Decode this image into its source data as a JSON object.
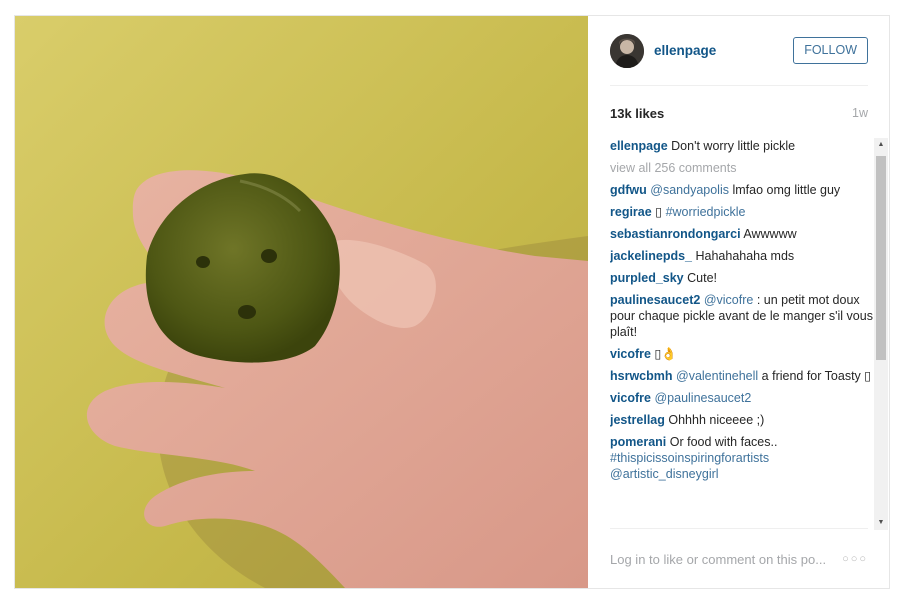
{
  "post": {
    "username": "ellenpage",
    "follow_label": "FOLLOW",
    "likes": "13k likes",
    "age": "1w",
    "caption": {
      "user": "ellenpage",
      "text": "Don't worry little pickle"
    },
    "view_all": "view all 256 comments"
  },
  "comments": [
    {
      "user": "gdfwu",
      "mention": "@sandyapolis",
      "text": "lmfao omg little guy"
    },
    {
      "user": "regirae",
      "mention": "#worriedpickle",
      "text": "▯"
    },
    {
      "user": "sebastianrondongarci",
      "mention": "",
      "text": "Awwwww"
    },
    {
      "user": "jackelinepds_",
      "mention": "",
      "text": "Hahahahaha mds"
    },
    {
      "user": "purpled_sky",
      "mention": "",
      "text": "Cute!"
    },
    {
      "user": "paulinesaucet2",
      "mention": "@vicofre",
      "text": ": un petit mot doux pour chaque pickle avant de le manger s'il vous plaît!"
    },
    {
      "user": "vicofre",
      "mention": "",
      "text": "▯👌"
    },
    {
      "user": "hsrwcbmh",
      "mention": "@valentinehell",
      "text": "a friend for Toasty ▯"
    },
    {
      "user": "vicofre",
      "mention": "@paulinesaucet2",
      "text": ""
    },
    {
      "user": "jestrellag",
      "mention": "",
      "text": "Ohhhh niceeee ;)"
    },
    {
      "user": "pomerani",
      "mention": "",
      "text": "Or food with faces..",
      "tags": "#thispicissoinspiringforartists @artistic_disneygirl"
    }
  ],
  "footer": {
    "login_text": "Log in to like or comment on this po...",
    "more": "○○○"
  },
  "scrollbar": {
    "up": "▲",
    "down": "▼"
  },
  "colors": {
    "username_blue": "#125688",
    "follow_blue": "#3f729b",
    "muted_grey": "#a5a7aa",
    "photo_wall": "#cdbf55"
  },
  "icons": {
    "more": "ellipsis-icon",
    "avatar": "profile-avatar"
  }
}
